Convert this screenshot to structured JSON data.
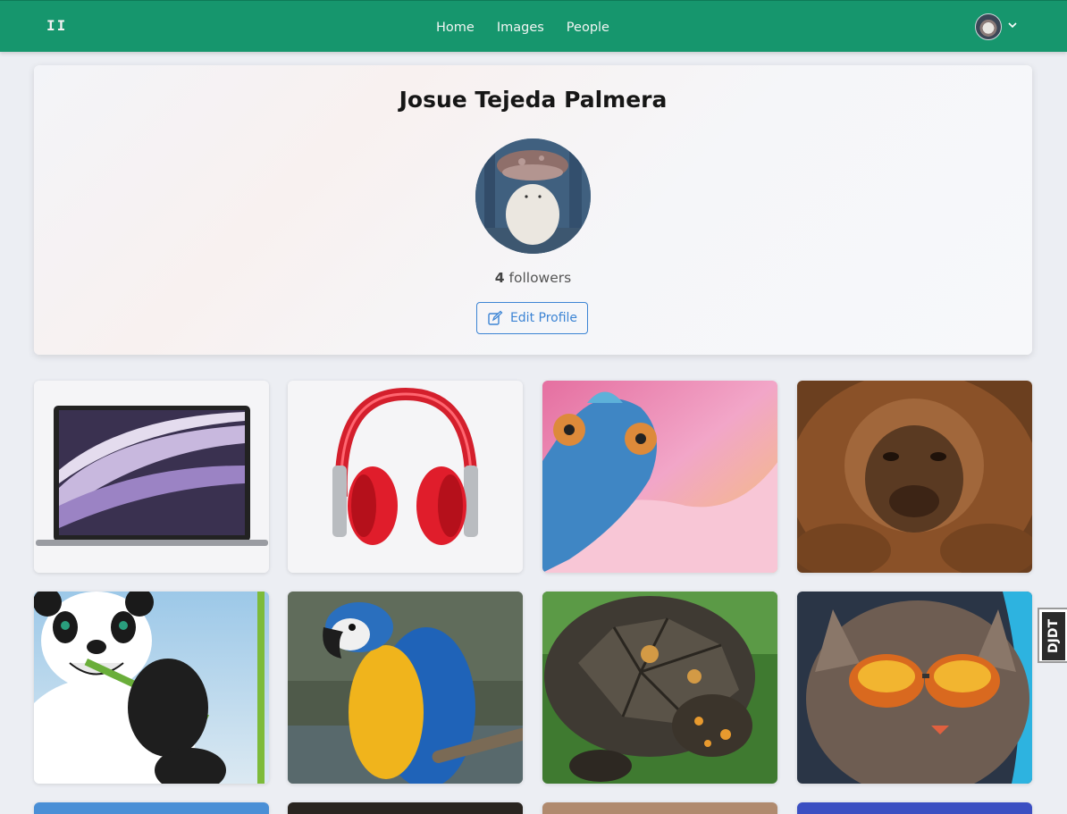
{
  "navbar": {
    "brand": "II",
    "links": [
      "Home",
      "Images",
      "People"
    ],
    "accent_color": "#16966d"
  },
  "profile": {
    "name": "Josue Tejeda Palmera",
    "followers_count": "4",
    "followers_label": "followers",
    "edit_button_label": "Edit Profile"
  },
  "gallery": {
    "tiles": [
      {
        "subject": "laptop"
      },
      {
        "subject": "headphones"
      },
      {
        "subject": "chameleon"
      },
      {
        "subject": "orangutan"
      },
      {
        "subject": "panda"
      },
      {
        "subject": "macaw"
      },
      {
        "subject": "tortoise"
      },
      {
        "subject": "cat-with-sunglasses"
      }
    ]
  },
  "side_badge": "DJDT"
}
